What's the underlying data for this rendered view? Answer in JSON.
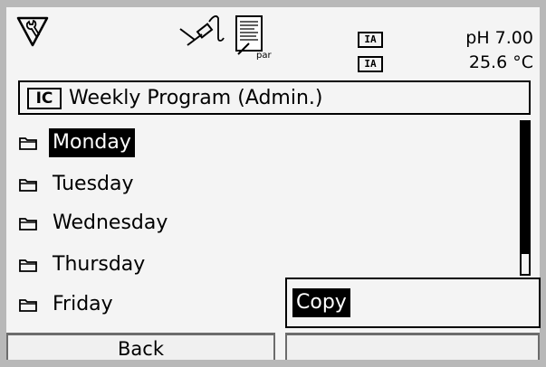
{
  "status": {
    "ia_labels": [
      "IA",
      "IA"
    ],
    "ph": "pH 7.00",
    "temperature": "25.6 °C",
    "par_label": "par"
  },
  "title_bar": {
    "badge": "IC",
    "title": "Weekly Program (Admin.)"
  },
  "days": [
    {
      "label": "Monday",
      "selected": true
    },
    {
      "label": "Tuesday",
      "selected": false
    },
    {
      "label": "Wednesday",
      "selected": false
    },
    {
      "label": "Thursday",
      "selected": false
    },
    {
      "label": "Friday",
      "selected": false
    }
  ],
  "popup": {
    "item": "Copy"
  },
  "softkeys": {
    "left": "Back",
    "right": ""
  },
  "colors": {
    "background": "#f4f4f4",
    "frame": "#b8b8b8",
    "selection": "#000000"
  }
}
